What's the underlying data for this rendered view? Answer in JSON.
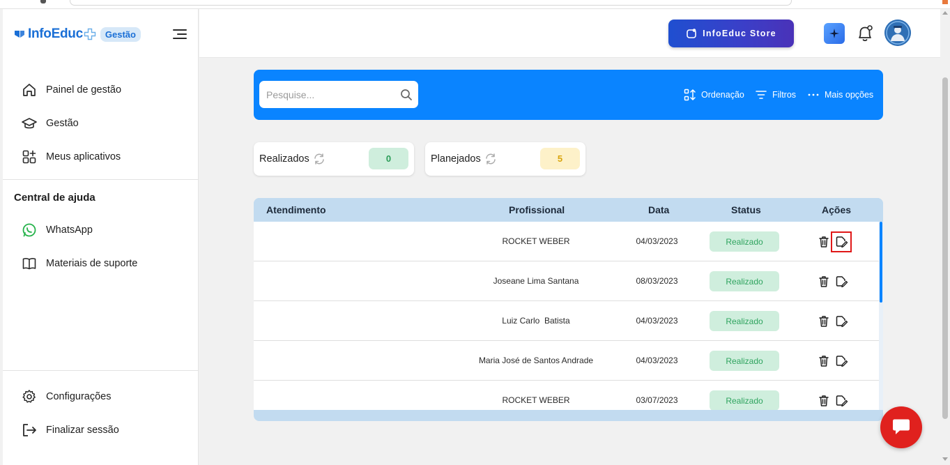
{
  "brand": {
    "name": "InfoEduc",
    "badge": "Gestão",
    "accent": "#1a6fd6"
  },
  "sidebar": {
    "items": [
      {
        "label": "Painel de gestão",
        "icon": "home-icon"
      },
      {
        "label": "Gestão",
        "icon": "graduation-cap-icon"
      },
      {
        "label": "Meus aplicativos",
        "icon": "apps-grid-icon"
      }
    ],
    "help_title": "Central de ajuda",
    "help_items": [
      {
        "label": "WhatsApp",
        "icon": "whatsapp-icon"
      },
      {
        "label": "Materiais de suporte",
        "icon": "book-icon"
      }
    ],
    "bottom_items": [
      {
        "label": "Configurações",
        "icon": "gear-icon"
      },
      {
        "label": "Finalizar sessão",
        "icon": "logout-icon"
      }
    ]
  },
  "header": {
    "store_label": "InfoEduc Store"
  },
  "search": {
    "placeholder": "Pesquise...",
    "value": ""
  },
  "toolbar": {
    "sort_label": "Ordenação",
    "filter_label": "Filtros",
    "more_label": "Mais opções"
  },
  "counters": {
    "done_label": "Realizados",
    "done_value": "0",
    "planned_label": "Planejados",
    "planned_value": "5"
  },
  "table": {
    "columns": [
      "Atendimento",
      "Profissional",
      "Data",
      "Status",
      "Ações"
    ],
    "rows": [
      {
        "atendimento": "",
        "profissional": "ROCKET WEBER",
        "data": "04/03/2023",
        "status": "Realizado"
      },
      {
        "atendimento": "",
        "profissional": "Joseane Lima Santana",
        "data": "08/03/2023",
        "status": "Realizado"
      },
      {
        "atendimento": "",
        "profissional": "Luiz Carlo  Batista",
        "data": "04/03/2023",
        "status": "Realizado"
      },
      {
        "atendimento": "",
        "profissional": "Maria José de Santos Andrade",
        "data": "04/03/2023",
        "status": "Realizado"
      },
      {
        "atendimento": "",
        "profissional": "ROCKET WEBER",
        "data": "03/07/2023",
        "status": "Realizado"
      }
    ]
  },
  "colors": {
    "primary_blue": "#0a84ff",
    "status_green_bg": "#cfeedd",
    "status_green_text": "#2fa45f",
    "planned_yellow_bg": "#fdf1c9",
    "done_green_bg": "#cfeedd",
    "chat_red": "#e0211e",
    "highlight_red": "#e01818"
  }
}
